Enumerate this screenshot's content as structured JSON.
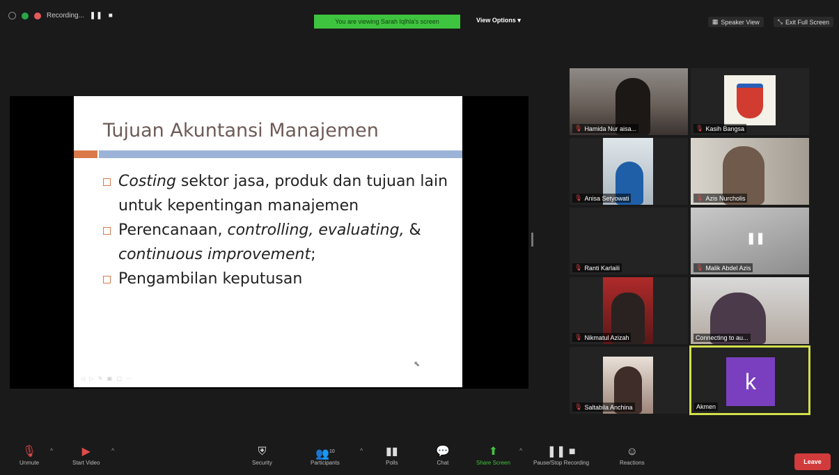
{
  "top": {
    "recording_label": "Recording...",
    "viewing_banner": "You are viewing Sarah Iqlhla's screen",
    "view_options": "View Options",
    "speaker_view": "Speaker View",
    "exit_full_screen": "Exit Full Screen"
  },
  "slide": {
    "title": "Tujuan Akuntansi Manajemen",
    "bullet1_em": "Costing",
    "bullet1_rest": " sektor jasa, produk dan tujuan lain untuk kepentingan manajemen",
    "bullet2_plain": "Perencanaan, ",
    "bullet2_em1": "controlling, evaluating,",
    "bullet2_amp": " & ",
    "bullet2_em2": "continuous improvement",
    "bullet2_end": ";",
    "bullet3": "Pengambilan keputusan"
  },
  "participants": [
    {
      "name": "Hamida Nur aisa..."
    },
    {
      "name": "Kasih Bangsa"
    },
    {
      "name": "Anisa Setyowati"
    },
    {
      "name": "Azis Nurcholis"
    },
    {
      "name": "Ranti Karlaili"
    },
    {
      "name": "Malik Abdel Azis"
    },
    {
      "name": "Nikmatul Azizah"
    },
    {
      "name": "Connecting to au..."
    },
    {
      "name": "Saltabila Anchina"
    },
    {
      "name": "Akmen",
      "initial": "k"
    }
  ],
  "toolbar": {
    "unmute": "Unmute",
    "start_video": "Start Video",
    "security": "Security",
    "participants": "Participants",
    "participants_count": "10",
    "polls": "Polls",
    "chat": "Chat",
    "share_screen": "Share Screen",
    "pause_stop_recording": "Pause/Stop Recording",
    "reactions": "Reactions",
    "leave": "Leave"
  },
  "colors": {
    "banner_green": "#3fc43f",
    "leave_red": "#d23b3b",
    "active_border": "#d2e04a",
    "avatar_purple": "#7a3fbf",
    "slide_orange": "#d9794a",
    "slide_blue": "#9bb3d6"
  }
}
